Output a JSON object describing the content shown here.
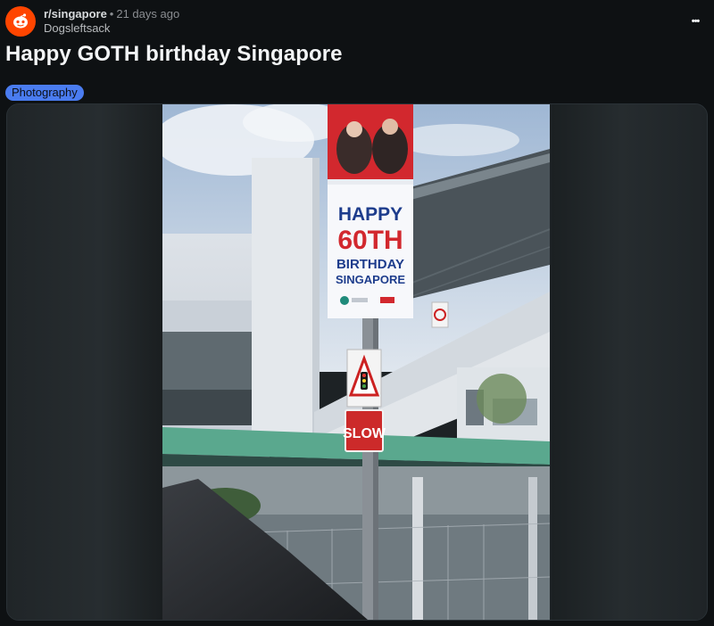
{
  "post": {
    "subreddit": "r/singapore",
    "separator": "•",
    "age": "21 days ago",
    "author": "Dogsleftsack",
    "more_label": "•••",
    "title": "Happy GOTH birthday Singapore",
    "flair": "Photography"
  },
  "photo": {
    "banner_line1": "HAPPY",
    "banner_line2": "60TH",
    "banner_line3": "BIRTHDAY",
    "banner_line4": "SINGAPORE",
    "slow_sign": "SLOW"
  },
  "colors": {
    "background": "#0e1113",
    "accent": "#ff4500",
    "flair": "#4a7cf0",
    "banner_red": "#d2282e",
    "banner_blue": "#1d3c8c",
    "roof_green": "#5aa88e"
  }
}
